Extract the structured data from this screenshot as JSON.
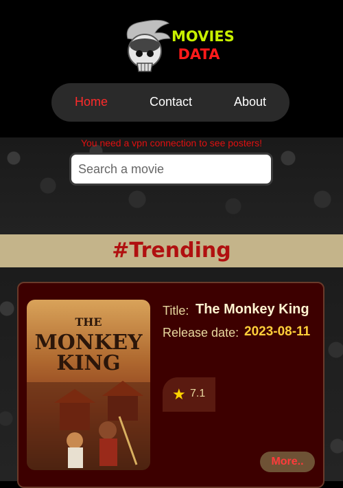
{
  "logo": {
    "line1": "MOVIES",
    "line2": "DATA"
  },
  "nav": {
    "home": "Home",
    "contact": "Contact",
    "about": "About"
  },
  "vpn_note": "You need a vpn connection to see posters!",
  "search": {
    "placeholder": "Search a movie"
  },
  "trending": {
    "title": "#Trending"
  },
  "movie": {
    "poster_title": {
      "line1": "THE",
      "line2": "MONKEY",
      "line3": "KING"
    },
    "title_label": "Title:",
    "title": "The Monkey King",
    "release_label": "Release date:",
    "release_date": "2023-08-11",
    "rating_icon": "star-icon",
    "rating": "7.1",
    "more_label": "More.."
  },
  "colors": {
    "active_nav": "#ff2a2a",
    "card_bg": "#3d0000",
    "trending_bg": "#c4b48a",
    "accent_gold": "#ffd400"
  }
}
